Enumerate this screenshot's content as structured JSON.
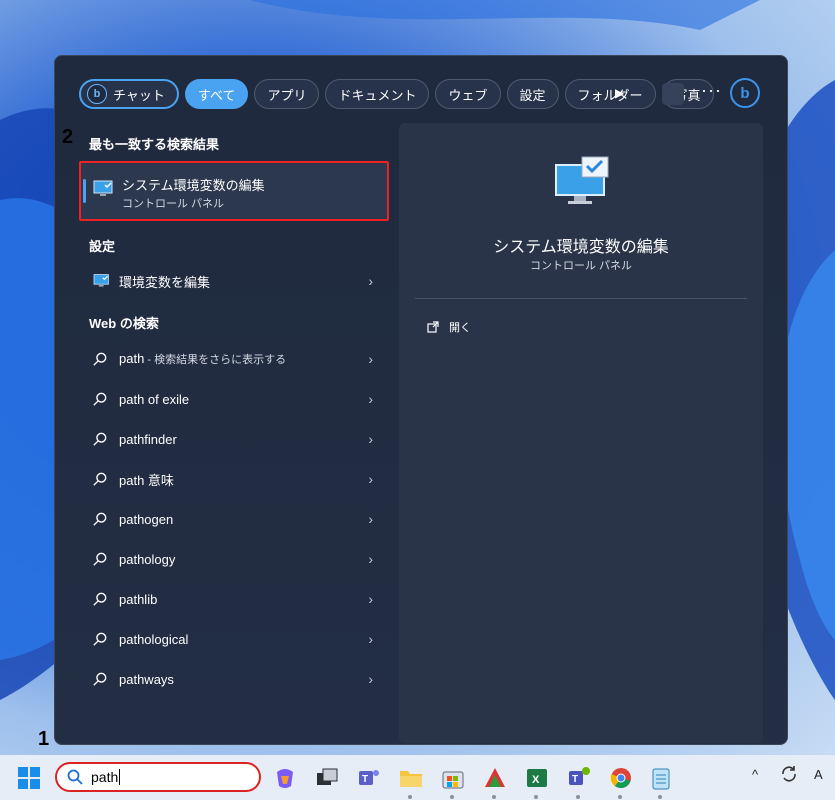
{
  "taskbar": {
    "search_value": "path",
    "input_language": "A"
  },
  "search_panel": {
    "tabs": [
      "チャット",
      "すべて",
      "アプリ",
      "ドキュメント",
      "ウェブ",
      "設定",
      "フォルダー",
      "写真"
    ],
    "active_tab": "すべて",
    "best_match": {
      "section_title": "最も一致する検索結果",
      "title": "システム環境変数の編集",
      "subtitle": "コントロール パネル"
    },
    "settings": {
      "section_title": "設定",
      "items": [
        {
          "label": "環境変数を編集"
        }
      ]
    },
    "web": {
      "section_title": "Web の検索",
      "items": [
        {
          "label": "path",
          "hint": " - 検索結果をさらに表示する"
        },
        {
          "label": "path of exile",
          "hint": ""
        },
        {
          "label": "pathfinder",
          "hint": ""
        },
        {
          "label": "path 意味",
          "hint": ""
        },
        {
          "label": "pathogen",
          "hint": ""
        },
        {
          "label": "pathology",
          "hint": ""
        },
        {
          "label": "pathlib",
          "hint": ""
        },
        {
          "label": "pathological",
          "hint": ""
        },
        {
          "label": "pathways",
          "hint": ""
        }
      ]
    },
    "detail": {
      "title": "システム環境変数の編集",
      "subtitle": "コントロール パネル",
      "action": "開く"
    }
  },
  "annotations": {
    "step1": "1",
    "step2": "2"
  },
  "colors": {
    "accent": "#4aa3f0",
    "highlight": "#e22222",
    "panel_bg": "#202b3f"
  }
}
